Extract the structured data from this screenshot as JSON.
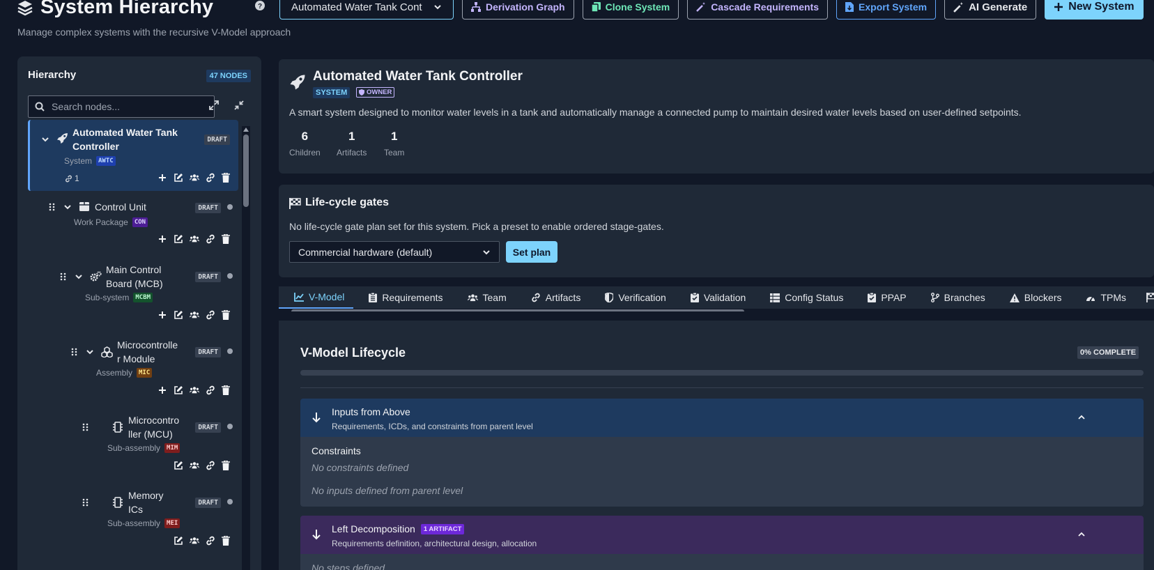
{
  "header": {
    "title": "System Hierarchy",
    "subtitle": "Manage complex systems with the recursive V-Model approach"
  },
  "toolbar": {
    "system_select": "Automated Water Tank Cont",
    "derivation_graph": "Derivation Graph",
    "clone_system": "Clone System",
    "cascade_requirements": "Cascade Requirements",
    "export_system": "Export System",
    "ai_generate": "AI Generate",
    "new_system": "New System"
  },
  "sidebar": {
    "title": "Hierarchy",
    "node_count": "47 NODES",
    "search_placeholder": "Search nodes...",
    "nodes": [
      {
        "name_line1": "Automated Water Tank",
        "name_line2": "Controller",
        "type": "System",
        "code": "AWTC",
        "status": "DRAFT",
        "links": "1"
      },
      {
        "name_line1": "Control Unit",
        "name_line2": "",
        "type": "Work Package",
        "code": "CON",
        "status": "DRAFT"
      },
      {
        "name_line1": "Main Control",
        "name_line2": "Board (MCB)",
        "type": "Sub-system",
        "code": "MCBM",
        "status": "DRAFT"
      },
      {
        "name_line1": "Microcontrolle",
        "name_line2": "r Module",
        "type": "Assembly",
        "code": "MIC",
        "status": "DRAFT"
      },
      {
        "name_line1": "Microcontro",
        "name_line2": "ller (MCU)",
        "type": "Sub-assembly",
        "code": "MIM",
        "status": "DRAFT"
      },
      {
        "name_line1": "Memory",
        "name_line2": "ICs",
        "type": "Sub-assembly",
        "code": "MEI",
        "status": "DRAFT"
      }
    ]
  },
  "system": {
    "title": "Automated Water Tank Controller",
    "type_tag": "SYSTEM",
    "role_tag": "OWNER",
    "description": "A smart system designed to monitor water levels in a tank and automatically manage a connected pump to maintain desired water levels based on user-defined setpoints.",
    "stats": [
      {
        "value": "6",
        "label": "Children"
      },
      {
        "value": "1",
        "label": "Artifacts"
      },
      {
        "value": "1",
        "label": "Team"
      }
    ]
  },
  "lifecycle": {
    "title": "Life-cycle gates",
    "description": "No life-cycle gate plan set for this system. Pick a preset to enable ordered stage-gates.",
    "preset": "Commercial hardware (default)",
    "set_plan": "Set plan"
  },
  "tabs": [
    {
      "label": "V-Model",
      "icon": "chart-line-icon"
    },
    {
      "label": "Requirements",
      "icon": "clipboard-icon"
    },
    {
      "label": "Team",
      "icon": "users-icon"
    },
    {
      "label": "Artifacts",
      "icon": "link-icon"
    },
    {
      "label": "Verification",
      "icon": "shield-icon"
    },
    {
      "label": "Validation",
      "icon": "clipboard-check-icon"
    },
    {
      "label": "Config Status",
      "icon": "table-icon"
    },
    {
      "label": "PPAP",
      "icon": "clipboard-check-icon"
    },
    {
      "label": "Branches",
      "icon": "branch-icon"
    },
    {
      "label": "Blockers",
      "icon": "warning-icon"
    },
    {
      "label": "TPMs",
      "icon": "gauge-icon"
    }
  ],
  "vmodel": {
    "title": "V-Model Lifecycle",
    "complete": "0% COMPLETE",
    "progress": 0,
    "inputs": {
      "title": "Inputs from Above",
      "subtitle": "Requirements, ICDs, and constraints from parent level",
      "constraints_label": "Constraints",
      "no_constraints": "No constraints defined",
      "no_inputs": "No inputs defined from parent level"
    },
    "left": {
      "title": "Left Decomposition",
      "badge": "1 ARTIFACT",
      "subtitle": "Requirements definition, architectural design, allocation",
      "no_steps": "No steps defined"
    }
  },
  "colors": {
    "background": "#111827",
    "panel": "#1f2937",
    "accent": "#7dd3fc",
    "selected_node": "#1e3a5f",
    "inputs_header": "#1e3a5f",
    "decomposition_header": "#3b2a5c"
  }
}
